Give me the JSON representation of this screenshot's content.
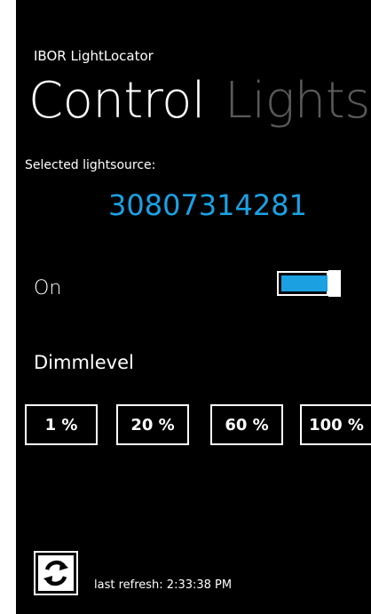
{
  "app": {
    "title": "IBOR LightLocator"
  },
  "pivot": {
    "active": "Control",
    "next": "Lightsource"
  },
  "selection": {
    "label": "Selected lightsource:",
    "value": "30807314281"
  },
  "power": {
    "label": "On",
    "is_on": true
  },
  "dimm": {
    "label": "Dimmlevel",
    "buttons": [
      "1 %",
      "20 %",
      "60 %",
      "100 %"
    ]
  },
  "footer": {
    "refresh_icon": "refresh-icon",
    "last_refresh": "last refresh: 2:33:38 PM"
  },
  "colors": {
    "accent": "#1ba1e2",
    "background": "#000000",
    "foreground": "#ffffff",
    "inactive": "#5a5a5a"
  }
}
